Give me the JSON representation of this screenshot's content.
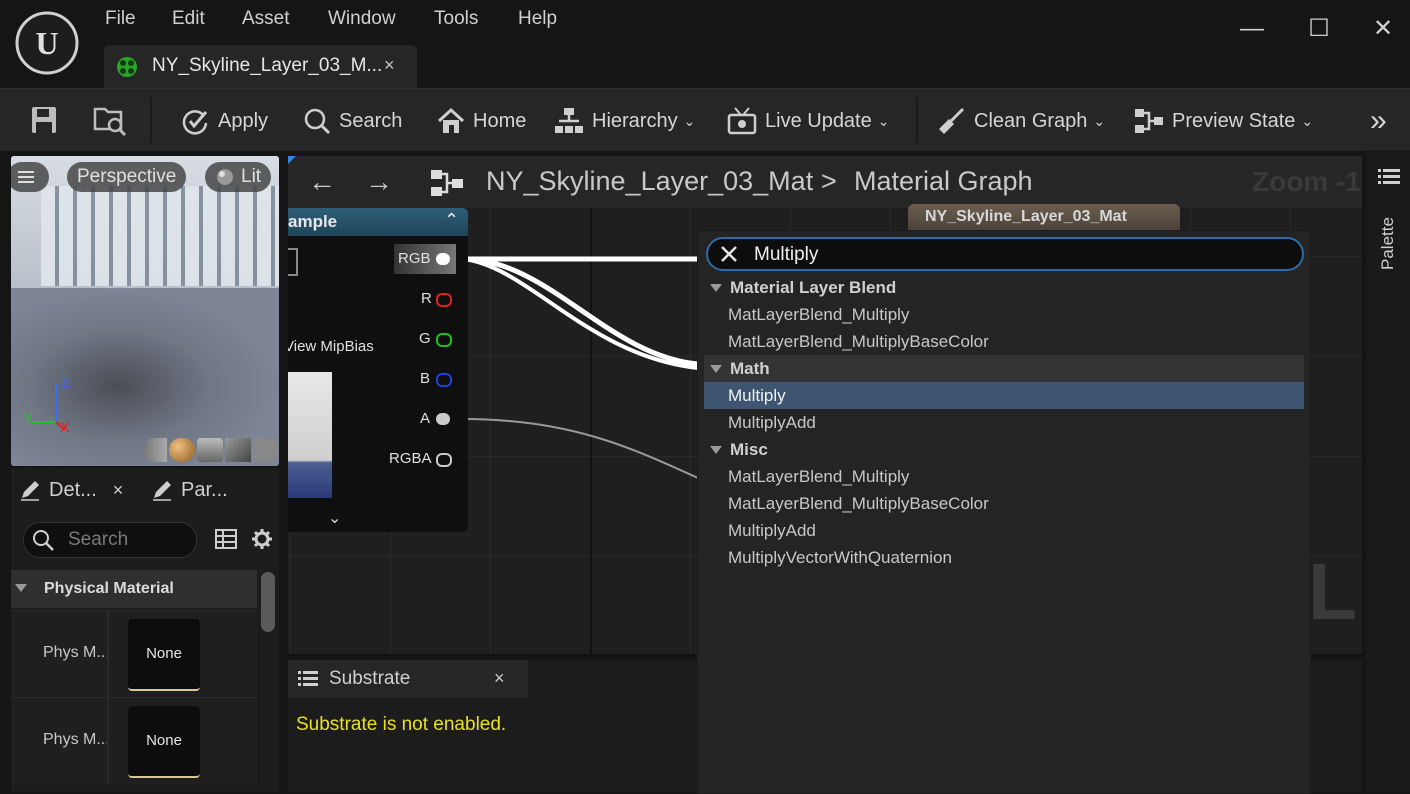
{
  "menu": [
    "File",
    "Edit",
    "Asset",
    "Window",
    "Tools",
    "Help"
  ],
  "tab": {
    "title": "NY_Skyline_Layer_03_M...",
    "close": "×"
  },
  "window_controls": {
    "minimize": "—",
    "maximize": "☐",
    "close": "✕"
  },
  "toolbar": {
    "apply": "Apply",
    "search": "Search",
    "home": "Home",
    "hierarchy": "Hierarchy",
    "live_update": "Live Update",
    "clean_graph": "Clean Graph",
    "preview_state": "Preview State",
    "more": "»"
  },
  "viewport": {
    "perspective": "Perspective",
    "lit": "Lit",
    "axis_z": "Z",
    "axis_y": "Y",
    "axis_x": "X"
  },
  "details": {
    "tab1": "Det...",
    "tab1_close": "×",
    "tab2": "Par...",
    "search_placeholder": "Search",
    "section": "Physical Material",
    "rows": [
      {
        "label": "Phys M...",
        "value": "None"
      },
      {
        "label": "Phys M...",
        "value": "None"
      }
    ]
  },
  "graph": {
    "breadcrumb_asset": "NY_Skyline_Layer_03_Mat",
    "breadcrumb_sep": ">",
    "breadcrumb_graph": "Material Graph",
    "zoom": "Zoom -1",
    "node_title": "ample",
    "node_pins": [
      "RGB",
      "R",
      "G",
      "B",
      "A",
      "RGBA"
    ],
    "node_mip_label": "View MipBias",
    "material_node_title": "NY_Skyline_Layer_03_Mat"
  },
  "substrate": {
    "tab": "Substrate",
    "close": "×",
    "message": "Substrate is not enabled."
  },
  "palette": {
    "label": "Palette"
  },
  "popup": {
    "search_value": "Multiply",
    "groups": [
      {
        "name": "Material Layer Blend",
        "items": [
          "MatLayerBlend_Multiply",
          "MatLayerBlend_MultiplyBaseColor"
        ]
      },
      {
        "name": "Math",
        "items": [
          "Multiply",
          "MultiplyAdd"
        ]
      },
      {
        "name": "Misc",
        "items": [
          "MatLayerBlend_Multiply",
          "MatLayerBlend_MultiplyBaseColor",
          "MultiplyAdd",
          "MultiplyVectorWithQuaternion"
        ]
      }
    ],
    "selected": "Multiply"
  },
  "colors": {
    "accent_blue": "#2d6aa8",
    "selection": "#3d5570",
    "warning_yellow": "#e8e020",
    "node_header": "#2e5f7a"
  }
}
